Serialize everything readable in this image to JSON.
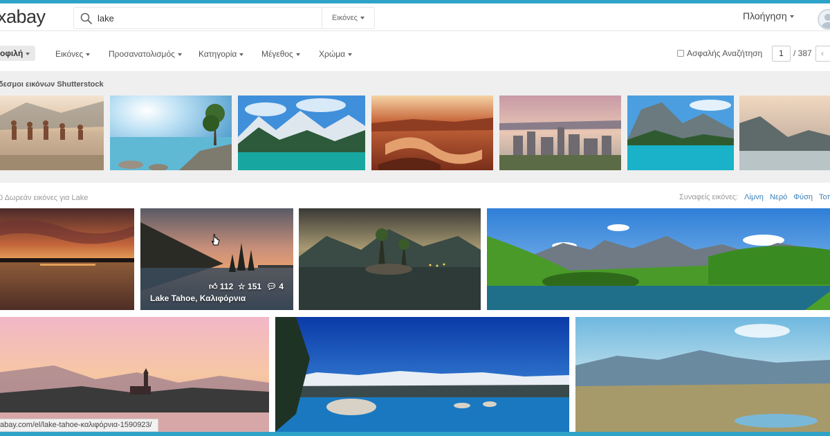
{
  "header": {
    "logo": "xabay",
    "search_value": "lake",
    "search_type": "Εικόνες",
    "explore": "Πλοήγηση"
  },
  "filters": {
    "first": "οφιλή",
    "items": [
      "Εικόνες",
      "Προσανατολισμός",
      "Κατηγορία",
      "Μέγεθος",
      "Χρώμα"
    ],
    "safe_search": "Ασφαλής Αναζήτηση",
    "page_current": "1",
    "page_total": "/ 387",
    "prev": "‹"
  },
  "sponsored": {
    "title": "δεσμοι εικόνων Shutterstock"
  },
  "results": {
    "count": "0 Δωρεάν εικόνες για Lake",
    "related_label": "Συναφείς εικόνες:",
    "related": [
      "Λίμνη",
      "Νερό",
      "Φύση",
      "Τοπ"
    ]
  },
  "featured_photo": {
    "likes": "112",
    "favorites": "151",
    "comments": "4",
    "title": "Lake Tahoe, Καλιφόρνια"
  },
  "status_url": "abay.com/el/lake-tahoe-καλιφόρνια-1590923/",
  "colors": {
    "accent": "#2ea3c7",
    "link": "#3b7fb7"
  }
}
